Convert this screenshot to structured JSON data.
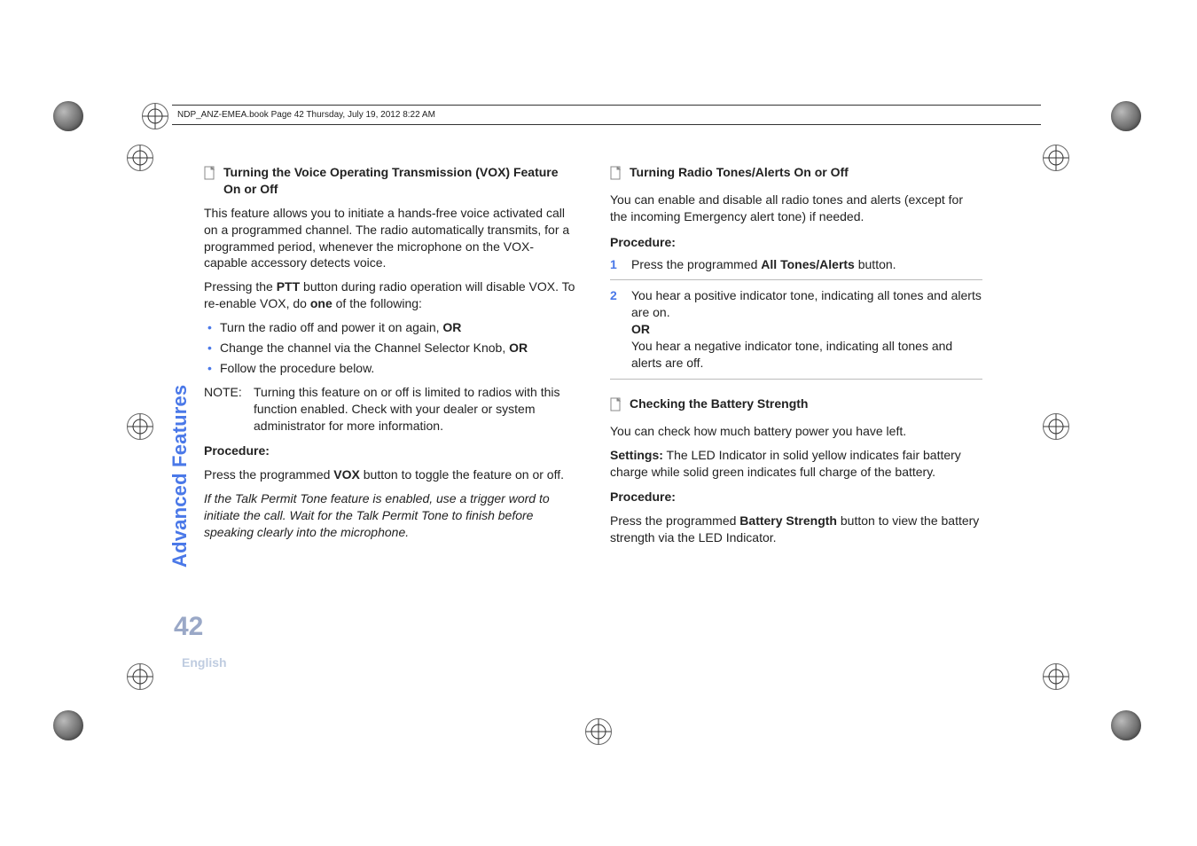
{
  "header": {
    "running_head": "NDP_ANZ-EMEA.book  Page 42  Thursday, July 19, 2012  8:22 AM"
  },
  "side": {
    "tab": "Advanced Features",
    "page_number": "42",
    "language": "English"
  },
  "left": {
    "heading": "Turning the Voice Operating Transmission (VOX) Feature On or Off",
    "p1a": "This feature allows you to initiate a hands-free voice activated call on a programmed channel. The radio automatically transmits, for a programmed period, whenever the microphone on the VOX-capable accessory detects voice.",
    "p2a": "Pressing the ",
    "p2b": "PTT",
    "p2c": " button during radio operation will disable VOX. To re-enable VOX, do ",
    "p2d": "one",
    "p2e": " of the following:",
    "b1a": "Turn the radio off and power it on again, ",
    "b1b": "OR",
    "b2a": "Change the channel via the Channel Selector Knob, ",
    "b2b": "OR",
    "b3": "Follow the procedure below.",
    "note_label": "NOTE:",
    "note_body": "Turning this feature on or off is limited to radios with this function enabled. Check with your dealer or system administrator for more information.",
    "proc": "Procedure:",
    "p3a": "Press the programmed ",
    "p3b": "VOX",
    "p3c": " button to toggle the feature on or off.",
    "italic": "If the Talk Permit Tone feature is enabled, use a trigger word to initiate the call. Wait for the Talk Permit Tone to finish before speaking clearly into the microphone."
  },
  "right": {
    "heading1": "Turning Radio Tones/Alerts On or Off",
    "p1": "You can enable and disable all radio tones and alerts (except for the incoming Emergency alert tone) if needed.",
    "proc1": "Procedure:",
    "s1num": "1",
    "s1a": "Press the programmed ",
    "s1b": "All Tones/Alerts",
    "s1c": " button.",
    "s2num": "2",
    "s2a": "You hear a positive indicator tone, indicating all tones and alerts are on.",
    "s2or": "OR",
    "s2b": "You hear a negative indicator tone, indicating all tones and alerts are off.",
    "heading2": "Checking the Battery Strength",
    "p2": "You can check how much battery power you have left.",
    "p3a": "Settings:",
    "p3b": " The LED Indicator in solid yellow indicates fair battery charge while solid green indicates full charge of the battery.",
    "proc2": "Procedure:",
    "p4a": "Press the programmed ",
    "p4b": "Battery Strength",
    "p4c": " button to view the battery strength via the LED Indicator."
  }
}
